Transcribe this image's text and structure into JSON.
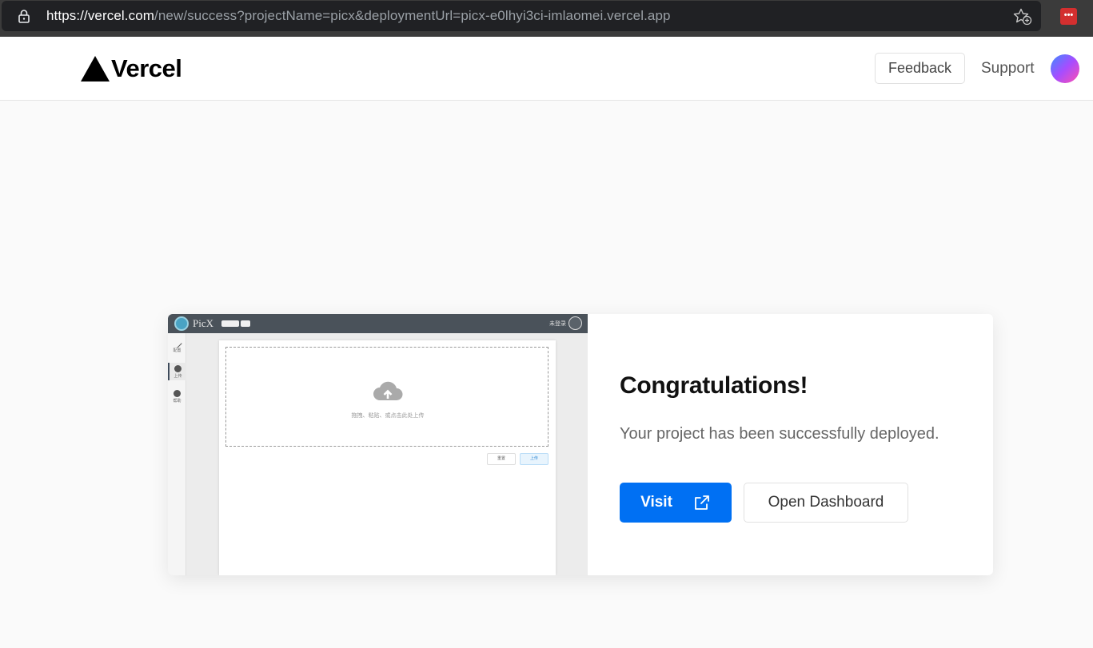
{
  "browser": {
    "url_prefix": "https://",
    "url_host": "vercel.com",
    "url_path": "/new/success?projectName=picx&deploymentUrl=picx-e0lhyi3ci-imlaomei.vercel.app",
    "extension_icon": "lastpass-icon",
    "extension_label": "•••"
  },
  "header": {
    "logo_text": "Vercel",
    "feedback_label": "Feedback",
    "support_label": "Support"
  },
  "preview": {
    "app_title": "PicX",
    "login_text": "未登录",
    "sidebar": [
      {
        "label": "配置",
        "icon": "edit-icon"
      },
      {
        "label": "上传",
        "icon": "upload-icon"
      },
      {
        "label": "帮助",
        "icon": "info-icon"
      }
    ],
    "drop_text": "拖拽、粘贴、或点击此处上传",
    "reset_label": "重置",
    "upload_label": "上传"
  },
  "success": {
    "heading": "Congratulations!",
    "message": "Your project has been successfully deployed.",
    "visit_label": "Visit",
    "dashboard_label": "Open Dashboard"
  },
  "colors": {
    "accent": "#0070f3",
    "browser_bar": "#3b3b3b",
    "page_bg": "#fafafa"
  }
}
